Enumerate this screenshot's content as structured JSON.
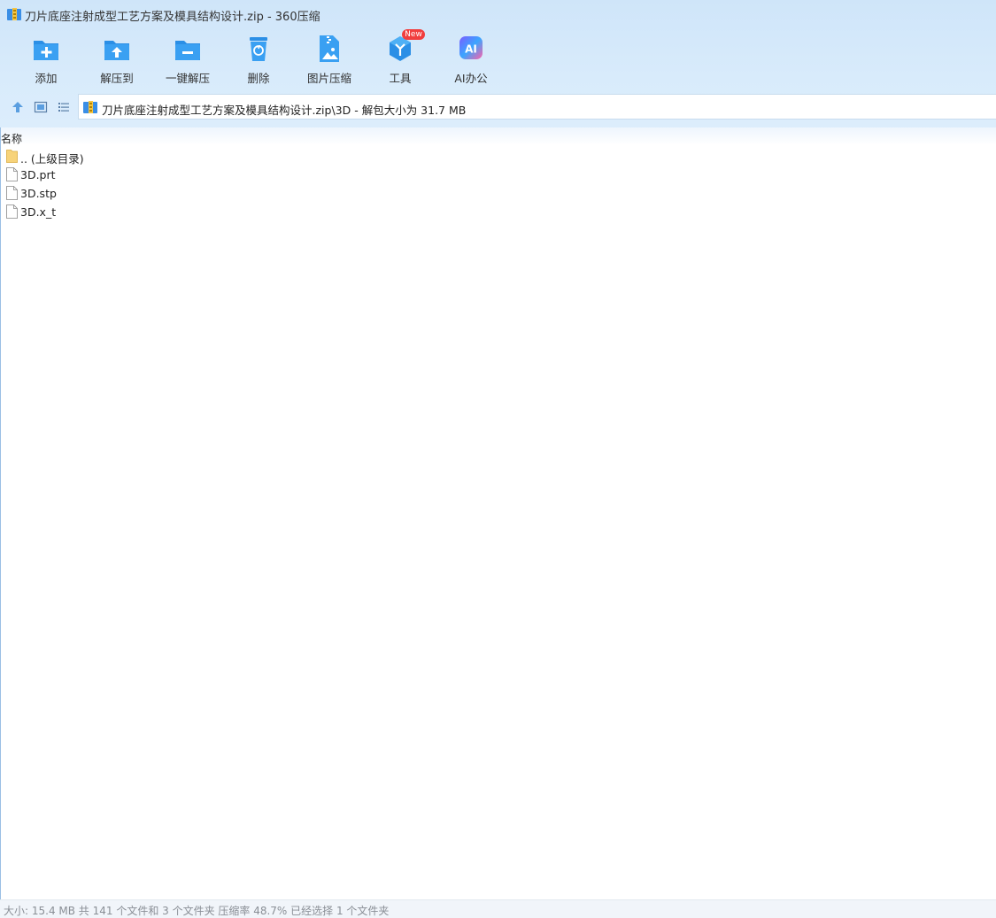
{
  "window": {
    "title": "刀片底座注射成型工艺方案及模具结构设计.zip - 360压缩"
  },
  "toolbar": {
    "items": [
      {
        "label": "添加",
        "icon": "folder-add-icon"
      },
      {
        "label": "解压到",
        "icon": "folder-extract-icon"
      },
      {
        "label": "一键解压",
        "icon": "folder-oneclick-icon"
      },
      {
        "label": "删除",
        "icon": "recycle-bin-icon"
      },
      {
        "label": "图片压缩",
        "icon": "image-compress-icon"
      },
      {
        "label": "工具",
        "icon": "tools-cube-icon",
        "badge": "New"
      },
      {
        "label": "AI办公",
        "icon": "ai-office-icon"
      }
    ]
  },
  "address": {
    "path": "刀片底座注射成型工艺方案及模具结构设计.zip\\3D - 解包大小为 31.7 MB"
  },
  "list": {
    "column_name": "名称",
    "rows": [
      {
        "name": ".. (上级目录)",
        "type": "folder"
      },
      {
        "name": "3D.prt",
        "type": "file"
      },
      {
        "name": "3D.stp",
        "type": "file"
      },
      {
        "name": "3D.x_t",
        "type": "file"
      }
    ]
  },
  "status": {
    "text": "大小: 15.4 MB 共 141 个文件和 3 个文件夹 压缩率 48.7% 已经选择 1 个文件夹"
  },
  "colors": {
    "accent": "#2b8fe6",
    "badge": "#f13e3e",
    "folder": "#f7d37a"
  }
}
